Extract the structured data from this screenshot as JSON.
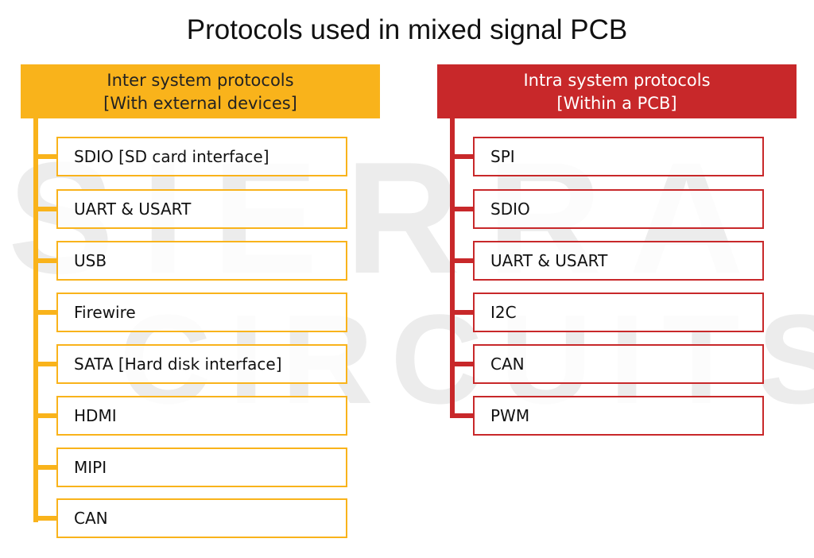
{
  "title": "Protocols used in mixed signal PCB",
  "watermark": {
    "line1": "SIERRA",
    "line2": "CIRCUITS"
  },
  "colors": {
    "inter": "#f9b31b",
    "intra": "#c8282a"
  },
  "inter": {
    "header_line1": "Inter system protocols",
    "header_line2": "[With external devices]",
    "items": [
      "SDIO [SD card interface]",
      "UART & USART",
      "USB",
      "Firewire",
      "SATA [Hard disk interface]",
      "HDMI",
      "MIPI",
      "CAN"
    ]
  },
  "intra": {
    "header_line1": "Intra system protocols",
    "header_line2": "[Within a PCB]",
    "items": [
      "SPI",
      "SDIO",
      "UART & USART",
      "I2C",
      "CAN",
      "PWM"
    ]
  }
}
